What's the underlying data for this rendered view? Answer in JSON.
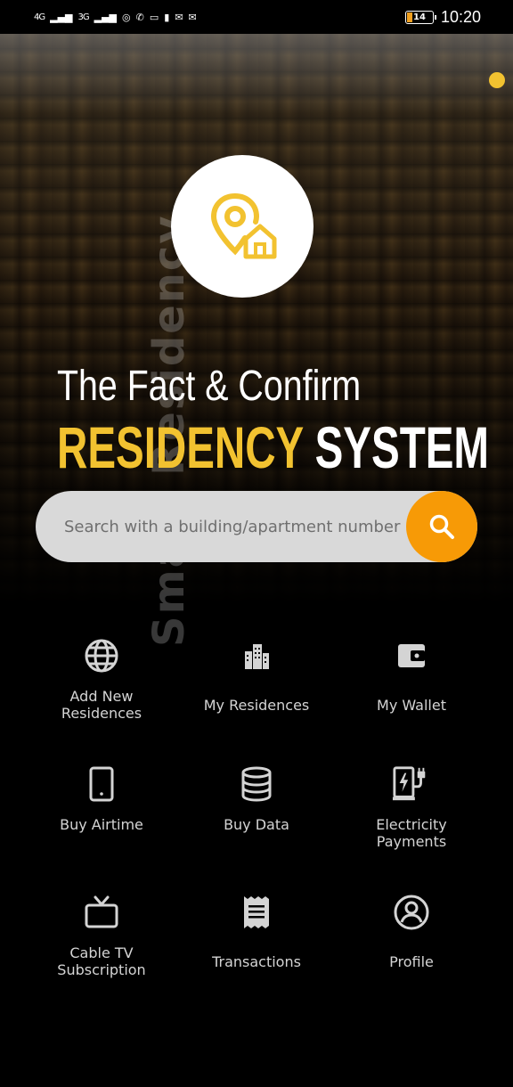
{
  "status_bar": {
    "network_1": "4G",
    "network_2": "3G",
    "battery": "14",
    "time": "10:20"
  },
  "hero": {
    "watermark": "Smart Residency",
    "title_line1": "The Fact & Confirm",
    "title_accent": "RESIDENCY",
    "title_plain": "SYSTEM",
    "logo_icon": "location-home-icon",
    "accent_color": "#f2c230"
  },
  "search": {
    "placeholder": "Search with a building/apartment number",
    "button_icon": "search-icon",
    "button_color": "#f79a06"
  },
  "menu": [
    {
      "label": "Add New\nResidences",
      "icon": "globe-icon"
    },
    {
      "label": "My Residences",
      "icon": "buildings-icon"
    },
    {
      "label": "My Wallet",
      "icon": "wallet-icon"
    },
    {
      "label": "Buy Airtime",
      "icon": "phone-icon"
    },
    {
      "label": "Buy Data",
      "icon": "database-icon"
    },
    {
      "label": "Electricity\nPayments",
      "icon": "charging-station-icon"
    },
    {
      "label": "Cable TV\nSubscription",
      "icon": "tv-icon"
    },
    {
      "label": "Transactions",
      "icon": "receipt-icon"
    },
    {
      "label": "Profile",
      "icon": "user-circle-icon"
    }
  ]
}
